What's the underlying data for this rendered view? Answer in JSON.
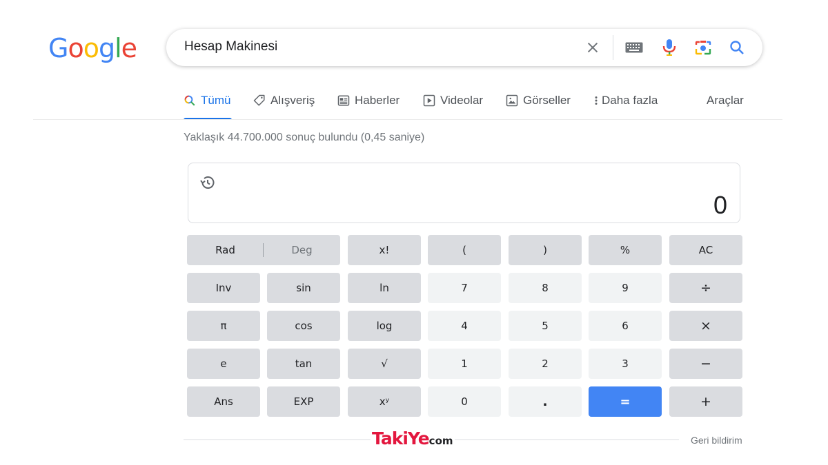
{
  "logo": {
    "letters": [
      "G",
      "o",
      "o",
      "g",
      "l",
      "e"
    ],
    "colors": [
      "#4285f4",
      "#ea4335",
      "#fbbc05",
      "#4285f4",
      "#34a853",
      "#ea4335"
    ]
  },
  "search": {
    "query": "Hesap Makinesi"
  },
  "tabs": [
    {
      "label": "Tümü",
      "icon": "search-icon",
      "active": true
    },
    {
      "label": "Alışveriş",
      "icon": "tag-icon"
    },
    {
      "label": "Haberler",
      "icon": "news-icon"
    },
    {
      "label": "Videolar",
      "icon": "play-icon"
    },
    {
      "label": "Görseller",
      "icon": "image-icon"
    },
    {
      "label": "Daha fazla",
      "icon": "more-vert-icon"
    },
    {
      "label": "Araçlar"
    }
  ],
  "stats": "Yaklaşık 44.700.000 sonuç bulundu (0,45 saniye)",
  "calculator": {
    "display": "0",
    "rad": "Rad",
    "deg": "Deg",
    "keys": {
      "fact": "x!",
      "lparen": "(",
      "rparen": ")",
      "percent": "%",
      "ac": "AC",
      "inv": "Inv",
      "sin": "sin",
      "ln": "ln",
      "seven": "7",
      "eight": "8",
      "nine": "9",
      "divide": "÷",
      "pi": "π",
      "cos": "cos",
      "log": "log",
      "four": "4",
      "five": "5",
      "six": "6",
      "multiply": "×",
      "e": "e",
      "tan": "tan",
      "sqrt": "√",
      "one": "1",
      "two": "2",
      "three": "3",
      "minus": "−",
      "ans": "Ans",
      "exp": "EXP",
      "pow": "xʸ",
      "zero": "0",
      "dot": ".",
      "equals": "=",
      "plus": "+"
    }
  },
  "footer": {
    "feedback": "Geri bildirim"
  },
  "watermark": {
    "brand": "TakiYe",
    "suffix": "com"
  }
}
